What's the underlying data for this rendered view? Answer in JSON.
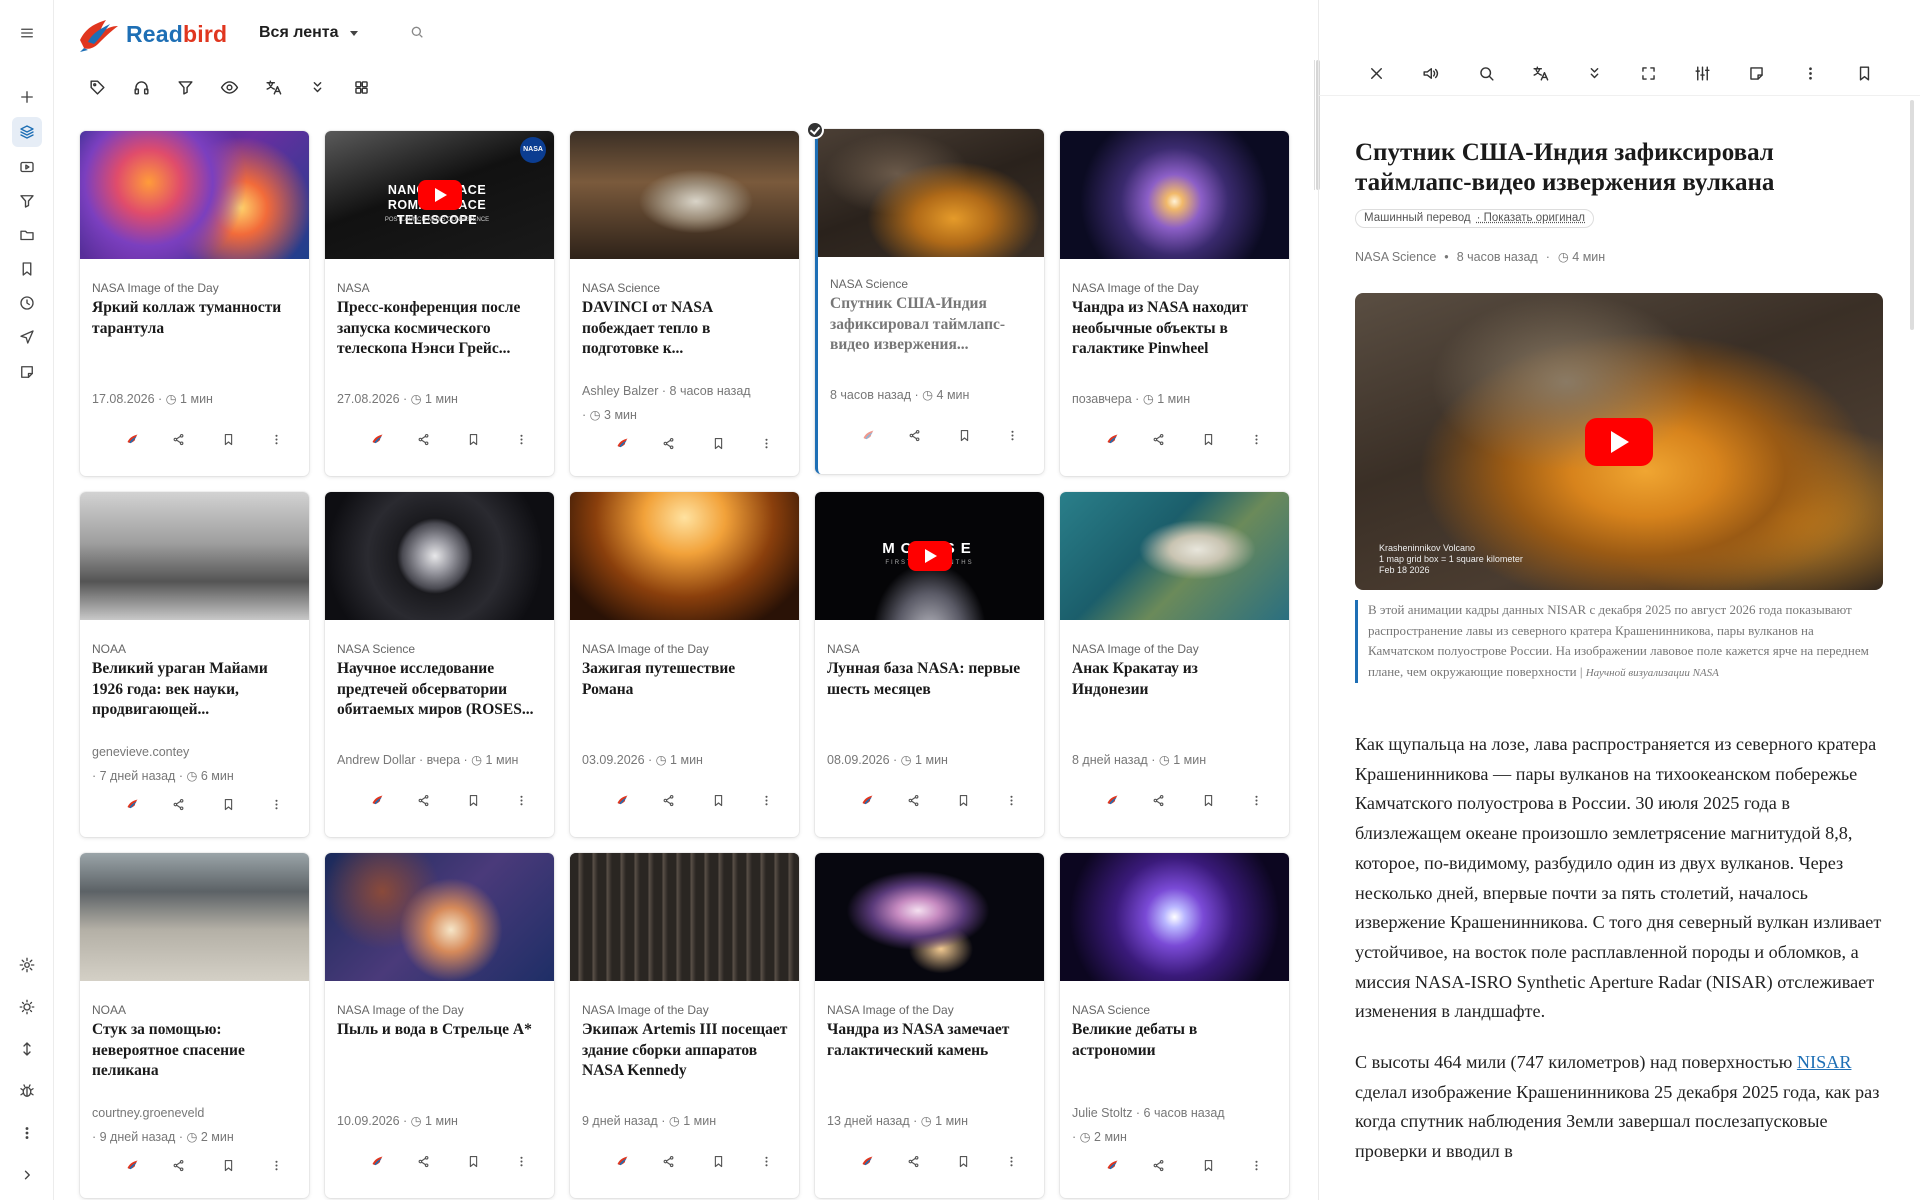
{
  "app": {
    "name_part1": "Read",
    "name_part2": "bird",
    "feed_selector": "Вся лента"
  },
  "colors": {
    "accent": "#1e6fb5",
    "logo_red": "#e0361f",
    "youtube": "#ff0000"
  },
  "rail_icons": [
    "menu-icon",
    "add-icon",
    "layers-icon",
    "video-icon",
    "filter-icon",
    "folder-icon",
    "bookmark-icon",
    "history-icon",
    "send-icon",
    "note-icon",
    "settings-icon",
    "theme-icon",
    "sort-icon",
    "bug-icon",
    "more-icon",
    "expand-icon"
  ],
  "toolbar_icons": [
    "tag-icon",
    "headphones-icon",
    "filter-icon",
    "eye-icon",
    "translate-icon",
    "chevrons-down-icon",
    "grid-view-icon"
  ],
  "cards": [
    {
      "source": "NASA Image of the Day",
      "title": "Яркий коллаж туманности тарантула",
      "meta1": "17.08.2026 · ◷ 1 мин",
      "meta2": ""
    },
    {
      "source": "NASA",
      "title": "Пресс-конференция после запуска космического телескопа Нэнси Грейс...",
      "meta1": "27.08.2026 · ◷ 1 мин",
      "meta2": "",
      "thumb_text": "NANCY GRACE ROMAN SPACE TELESCOPE",
      "thumb_sub": "POSTLAUNCH NEWS CONFERENCE"
    },
    {
      "source": "NASA Science",
      "title": "DAVINCI от NASA побеждает тепло в подготовке к...",
      "meta1": "Ashley Balzer · 8 часов назад",
      "meta2": "· ◷ 3 мин"
    },
    {
      "source": "NASA Science",
      "title": "Спутник США-Индия зафиксировал таймлапс-видео извержения...",
      "meta1": "8 часов назад · ◷ 4 мин",
      "meta2": ""
    },
    {
      "source": "NASA Image of the Day",
      "title": "Чандра из NASA находит необычные объекты в галактике Pinwheel",
      "meta1": "позавчера · ◷ 1 мин",
      "meta2": ""
    },
    {
      "source": "NOAA",
      "title": "Великий ураган Майами 1926 года: век науки, продвигающей...",
      "meta1": "genevieve.contey",
      "meta2": "· 7 дней назад · ◷ 6 мин"
    },
    {
      "source": "NASA Science",
      "title": "Научное исследование предтечей обсерватории обитаемых миров (ROSES...",
      "meta1": "Andrew Dollar · вчера · ◷ 1 мин",
      "meta2": ""
    },
    {
      "source": "NASA Image of the Day",
      "title": "Зажигая путешествие Романа",
      "meta1": "03.09.2026 · ◷ 1 мин",
      "meta2": ""
    },
    {
      "source": "NASA",
      "title": "Лунная база NASA: первые шесть месяцев",
      "meta1": "08.09.2026 · ◷ 1 мин",
      "meta2": "",
      "thumb_text": "MO  ASE",
      "thumb_sub": "FIRST SIX MONTHS"
    },
    {
      "source": "NASA Image of the Day",
      "title": "Анак Кракатау из Индонезии",
      "meta1": "8 дней назад · ◷ 1 мин",
      "meta2": ""
    },
    {
      "source": "NOAA",
      "title": "Стук за помощью: невероятное спасение пеликана",
      "meta1": "courtney.groeneveld",
      "meta2": "· 9 дней назад · ◷ 2 мин"
    },
    {
      "source": "NASA Image of the Day",
      "title": "Пыль и вода в Стрельце A*",
      "meta1": "10.09.2026 · ◷ 1 мин",
      "meta2": ""
    },
    {
      "source": "NASA Image of the Day",
      "title": "Экипаж Artemis III посещает здание сборки аппаратов NASA Kennedy",
      "meta1": "9 дней назад · ◷ 1 мин",
      "meta2": ""
    },
    {
      "source": "NASA Image of the Day",
      "title": "Чандра из NASA замечает галактический камень",
      "meta1": "13 дней назад · ◷ 1 мин",
      "meta2": ""
    },
    {
      "source": "NASA Science",
      "title": "Великие дебаты в астрономии",
      "meta1": "Julie Stoltz · 6 часов назад",
      "meta2": "· ◷ 2 мин"
    }
  ],
  "reader": {
    "tool_icons": [
      "close-icon",
      "speaker-icon",
      "search-icon",
      "translate-icon",
      "chevrons-down-icon",
      "fullscreen-icon",
      "sliders-icon",
      "note-icon",
      "more-icon",
      "bookmark-icon"
    ],
    "title": "Спутник США-Индия зафиксировал таймлапс-видео извержения вулкана",
    "mt_label": "Машинный перевод",
    "mt_link": "· Показать оригинал",
    "source": "NASA Science",
    "time": "8 часов назад",
    "read": "◷ 4 мин",
    "video_caption1": "Krasheninnikov Volcano",
    "video_caption2": "1 map grid box = 1 square kilometer",
    "video_caption3": "Feb 18 2026",
    "caption": "В этой анимации кадры данных NISAR с декабря 2025 по август 2026 года показывают распространение лавы из северного кратера Крашенинникова, пары вулканов на Камчатском полуострове России. На изображении лавовое поле кажется ярче на переднем плане, чем окружающие поверхности |",
    "caption_credit": "Научной визуализации NASA",
    "p1": "Как щупальца на лозе, лава распространяется из северного кратера Крашенинникова — пары вулканов на тихоокеанском побережье Камчатского полуострова в России. 30 июля 2025 года в близлежащем океане произошло землетрясение магнитудой 8,8, которое, по-видимому, разбудило один из двух вулканов. Через несколько дней, впервые почти за пять столетий, началось извержение Крашенинникова. С того дня северный вулкан изливает устойчивое, на восток поле расплавленной породы и обломков, а миссия NASA-ISRO Synthetic Aperture Radar (NISAR) отслеживает изменения в ландшафте.",
    "p2_a": "С высоты 464 мили (747 километров) над поверхностью",
    "p2_link": "NISAR",
    "p2_b": "сделал изображение Крашенинникова 25 декабря 2025 года, как раз когда спутник наблюдения Земли завершал послезапусковые проверки и вводил в"
  }
}
